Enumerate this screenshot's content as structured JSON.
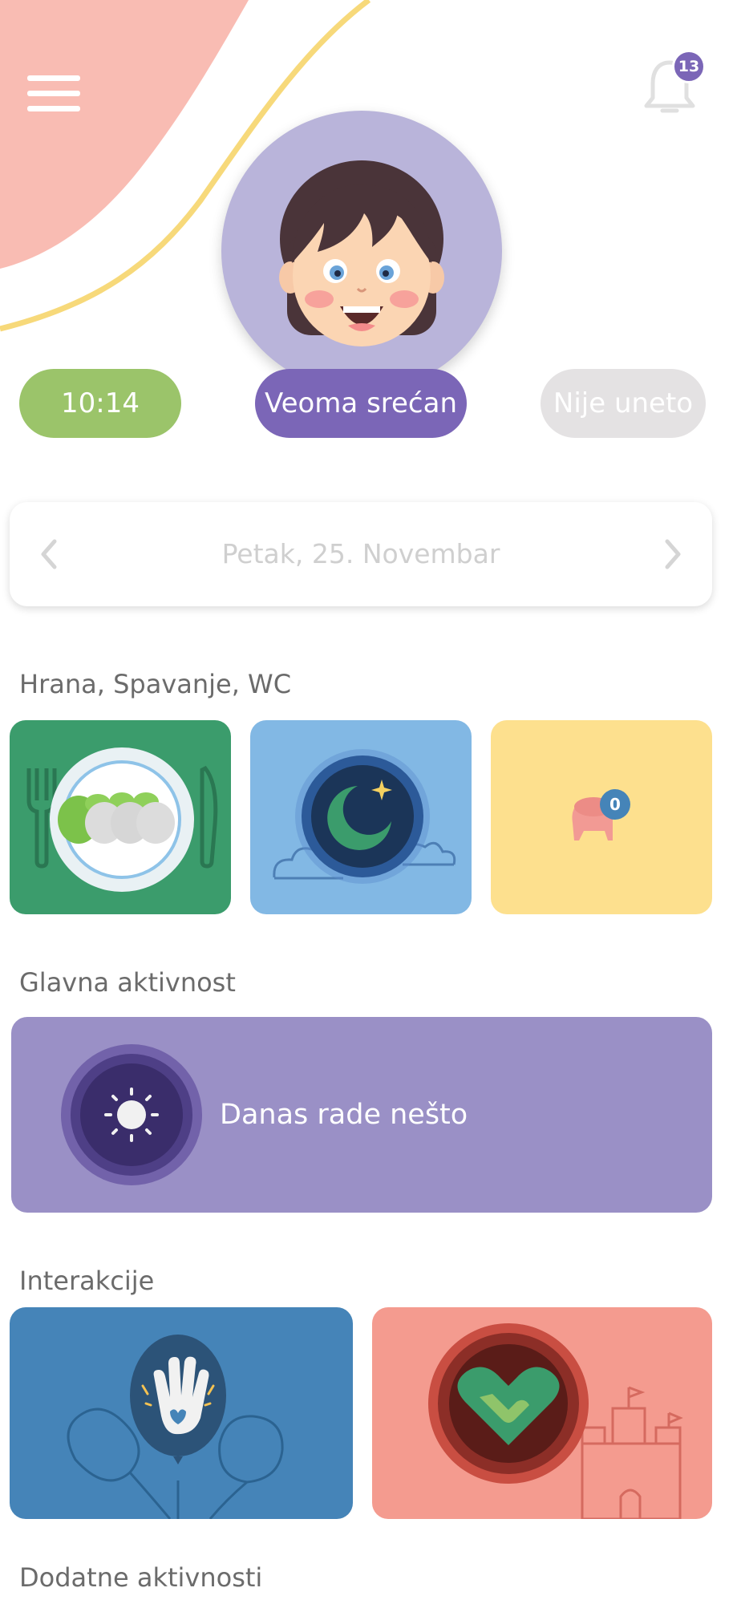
{
  "header": {
    "notification_count": "13"
  },
  "status": {
    "time": "10:14",
    "mood": "Veoma srećan",
    "other": "Nije uneto"
  },
  "date_nav": {
    "date_label": "Petak, 25. Novembar"
  },
  "sections": {
    "food_sleep_wc": "Hrana, Spavanje, WC",
    "main_activity": "Glavna aktivnost",
    "interactions": "Interakcije",
    "additional": "Dodatne aktivnosti"
  },
  "toilet_badge": "0",
  "main_activity_text": "Danas rade nešto",
  "colors": {
    "green": "#9bc46a",
    "purple": "#7b66b7",
    "grey_pill": "#e4e2e3",
    "food": "#3b9c6c",
    "sleep": "#82b8e4",
    "wc": "#fde08e",
    "activity": "#9a90c6",
    "interact_blue": "#4584b8",
    "interact_pink": "#f49b8f"
  },
  "icons": {
    "menu": "hamburger-icon",
    "bell": "bell-icon",
    "prev": "chevron-left-icon",
    "next": "chevron-right-icon",
    "food": "plate-icon",
    "sleep": "moon-icon",
    "wc": "potty-icon",
    "activity": "sun-icon",
    "interaction1": "hand-icon",
    "interaction2": "handshake-heart-icon"
  }
}
